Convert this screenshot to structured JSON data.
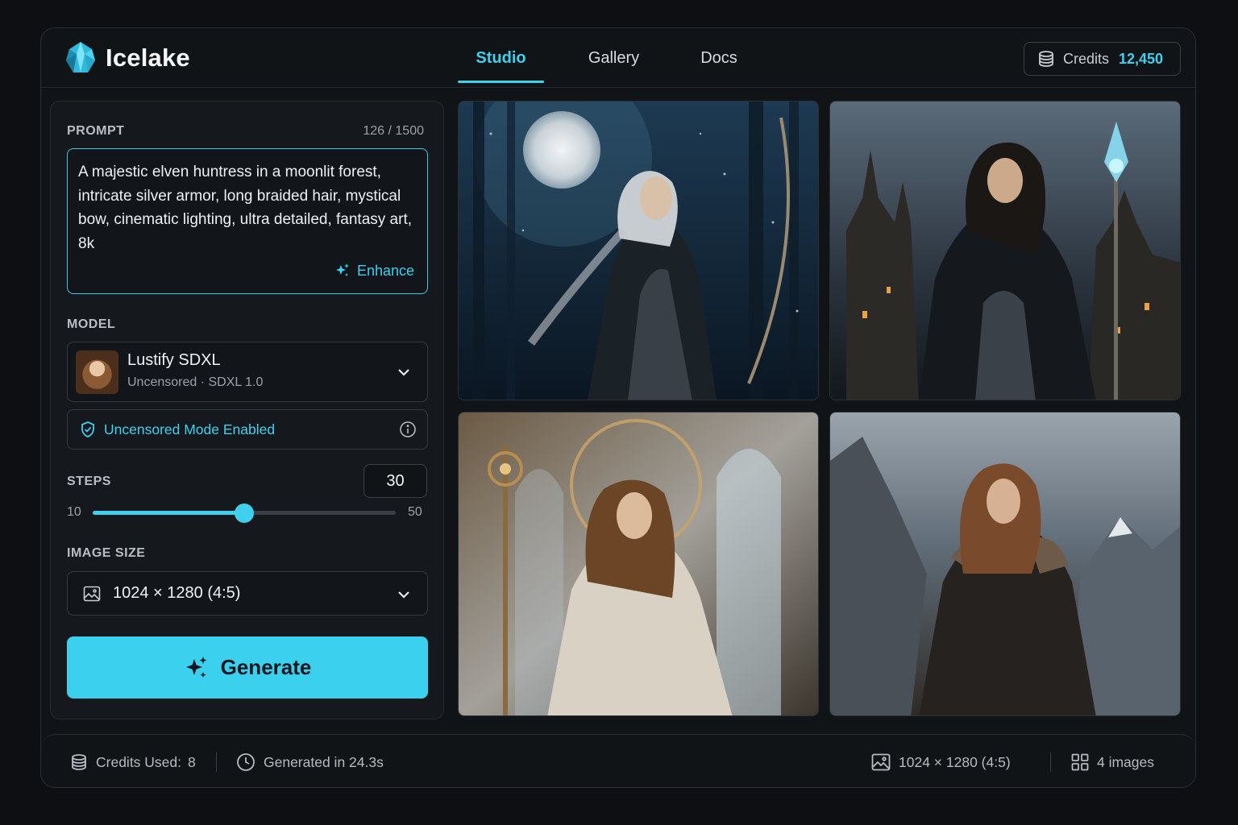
{
  "app": {
    "name": "Icelake",
    "brand_color": "#3fd0ee"
  },
  "nav": {
    "tabs": [
      {
        "label": "Studio",
        "active": true
      },
      {
        "label": "Gallery",
        "active": false
      },
      {
        "label": "Docs",
        "active": false
      }
    ]
  },
  "credits": {
    "label": "Credits",
    "value": "12,450"
  },
  "prompt": {
    "label": "PROMPT",
    "count": "126 / 1500",
    "text": "A majestic elven huntress in a moonlit forest, intricate silver armor, long braided hair, mystical bow, cinematic lighting, ultra detailed, fantasy art, 8k",
    "enhance_label": "Enhance"
  },
  "model": {
    "label": "MODEL",
    "name": "Lustify SDXL",
    "subtitle": "Uncensored · SDXL 1.0",
    "mode_notice": "Uncensored Mode Enabled"
  },
  "steps": {
    "label": "STEPS",
    "value": "30",
    "min": "10",
    "max": "50",
    "fraction": 0.5
  },
  "image_size": {
    "label": "IMAGE SIZE",
    "value": "1024 × 1280 (4:5)"
  },
  "generate": {
    "label": "Generate"
  },
  "footer": {
    "credits_used_label": "Credits Used:",
    "credits_used_value": "8",
    "generated_time": "Generated in 24.3s",
    "dimensions": "1024 × 1280 (4:5)",
    "image_count": "4 images"
  },
  "results": [
    {
      "subject": "elven huntress with bow, moonlit forest"
    },
    {
      "subject": "dark sorceress with crystal staff, castle"
    },
    {
      "subject": "priestess with golden staff, cathedral"
    },
    {
      "subject": "ranger in fur cloak, mountains"
    }
  ]
}
